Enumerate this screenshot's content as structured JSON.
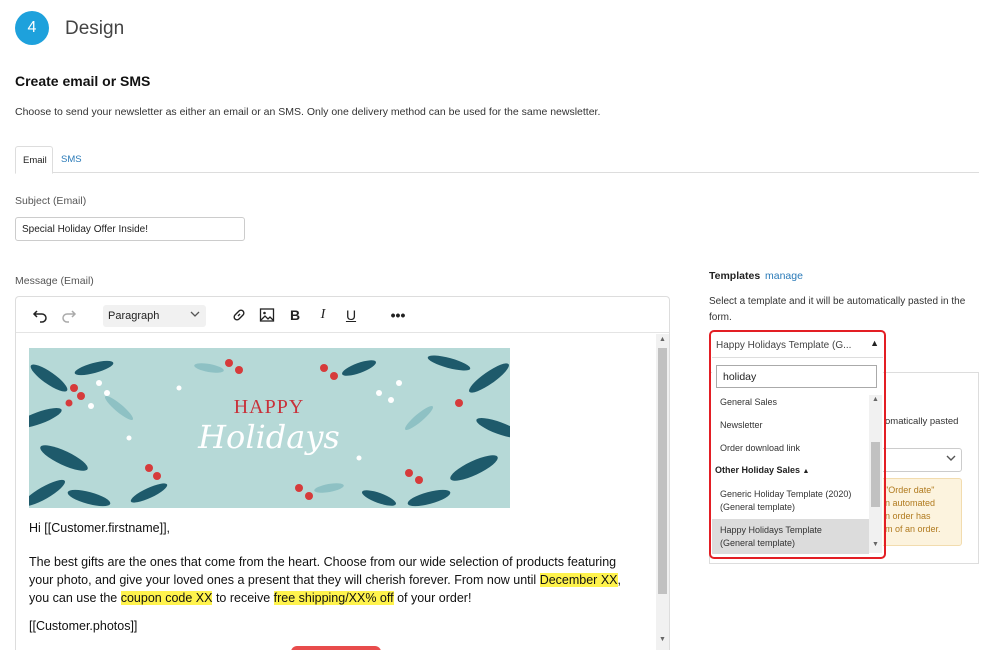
{
  "step": {
    "number": "4",
    "title": "Design"
  },
  "section": {
    "title": "Create email or SMS",
    "description": "Choose to send your newsletter as either an email or an SMS. Only one delivery method can be used for the same newsletter."
  },
  "tabs": [
    {
      "label": "Email"
    },
    {
      "label": "SMS"
    }
  ],
  "subject": {
    "label": "Subject (Email)",
    "value": "Special Holiday Offer Inside!"
  },
  "message": {
    "label": "Message (Email)",
    "format": "Paragraph",
    "banner_text_1": "HAPPY",
    "banner_text_2": "Holidays",
    "greeting": "Hi [[Customer.firstname]],",
    "p_part1": "The best gifts are the ones that come from the heart. Choose from our wide selection of products featuring your photo, and give your loved ones a present that they will cherish forever. From now until ",
    "p_hl1": "December XX",
    "p_part2": ", you can use the ",
    "p_hl2": "coupon code XX",
    "p_part3": " to receive ",
    "p_hl3": "free shipping/XX% off",
    "p_part4": " of your order!",
    "photos_tag": "[[Customer.photos]]"
  },
  "templates": {
    "title": "Templates",
    "manage": "manage",
    "description": "Select a template and it will be automatically pasted in the form.",
    "selected": "Happy Holidays Template (G...",
    "search": "holiday",
    "items": [
      {
        "label": "General Sales"
      },
      {
        "label": "Newsletter"
      },
      {
        "label": "Order download link"
      }
    ],
    "group": "Other Holiday Sales",
    "group_items": [
      {
        "line1": "Generic Holiday Template (2020)",
        "line2": "(General template)"
      },
      {
        "line1": "Happy Holidays Template",
        "line2": "(General template)"
      }
    ]
  },
  "background": {
    "text1": "omatically pasted",
    "warn1": "\"Order date\"",
    "warn2": "n automated",
    "warn3": "n order has",
    "warn4": "m of an order."
  },
  "colors": {
    "accent": "#1ea1dc",
    "highlight": "#fff34d",
    "focus_ring": "#e31e24",
    "link": "#2a7ab8"
  }
}
